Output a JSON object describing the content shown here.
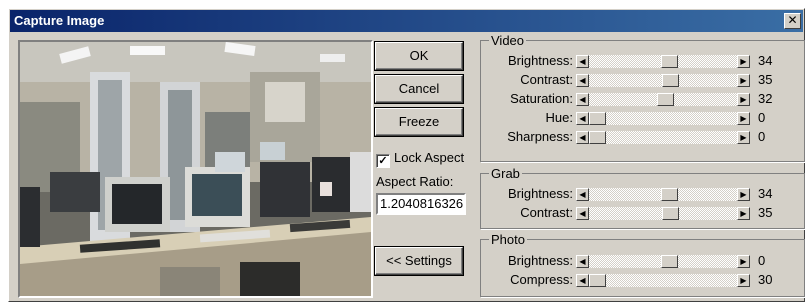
{
  "window": {
    "title": "Capture Image",
    "close_symbol": "✕"
  },
  "buttons": {
    "ok": "OK",
    "cancel": "Cancel",
    "freeze": "Freeze",
    "settings": "<< Settings"
  },
  "lock_aspect": {
    "label": "Lock Aspect",
    "checked": true
  },
  "aspect_ratio": {
    "label": "Aspect Ratio:",
    "value": "1.2040816326"
  },
  "groups": {
    "video": {
      "title": "Video",
      "sliders": [
        {
          "label": "Brightness:",
          "value": "34",
          "fraction": 0.55
        },
        {
          "label": "Contrast:",
          "value": "35",
          "fraction": 0.56
        },
        {
          "label": "Saturation:",
          "value": "32",
          "fraction": 0.52
        },
        {
          "label": "Hue:",
          "value": "0",
          "fraction": 0.0
        },
        {
          "label": "Sharpness:",
          "value": "0",
          "fraction": 0.0
        }
      ]
    },
    "grab": {
      "title": "Grab",
      "sliders": [
        {
          "label": "Brightness:",
          "value": "34",
          "fraction": 0.55
        },
        {
          "label": "Contrast:",
          "value": "35",
          "fraction": 0.56
        }
      ]
    },
    "photo": {
      "title": "Photo",
      "sliders": [
        {
          "label": "Brightness:",
          "value": "0",
          "fraction": 0.55
        },
        {
          "label": "Compress:",
          "value": "30",
          "fraction": 0.0
        }
      ]
    }
  }
}
